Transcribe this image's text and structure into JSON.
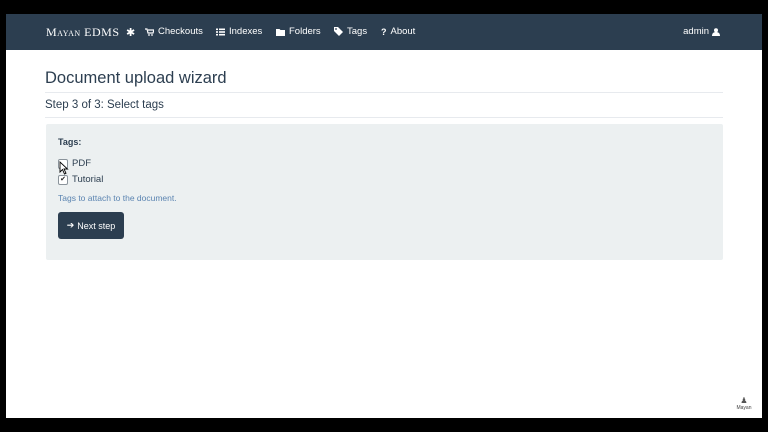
{
  "navbar": {
    "brand": "Mayan EDMS",
    "items": [
      {
        "label": "Checkouts",
        "icon": "cart-icon"
      },
      {
        "label": "Indexes",
        "icon": "list-icon"
      },
      {
        "label": "Folders",
        "icon": "folder-icon"
      },
      {
        "label": "Tags",
        "icon": "tag-icon"
      },
      {
        "label": "About",
        "icon": "question-icon"
      }
    ],
    "user": "admin"
  },
  "page": {
    "title": "Document upload wizard",
    "subtitle": "Step 3 of 3: Select tags"
  },
  "form": {
    "field_label": "Tags:",
    "options": [
      {
        "label": "PDF",
        "checked": false
      },
      {
        "label": "Tutorial",
        "checked": true
      }
    ],
    "help_text": "Tags to attach to the document.",
    "next_button": "Next step"
  },
  "watermark": "Mayan",
  "colors": {
    "navbar": "#2c3e50",
    "panel": "#ecf0f1",
    "help_text": "#5b84b1",
    "frame_border": "#000000"
  }
}
